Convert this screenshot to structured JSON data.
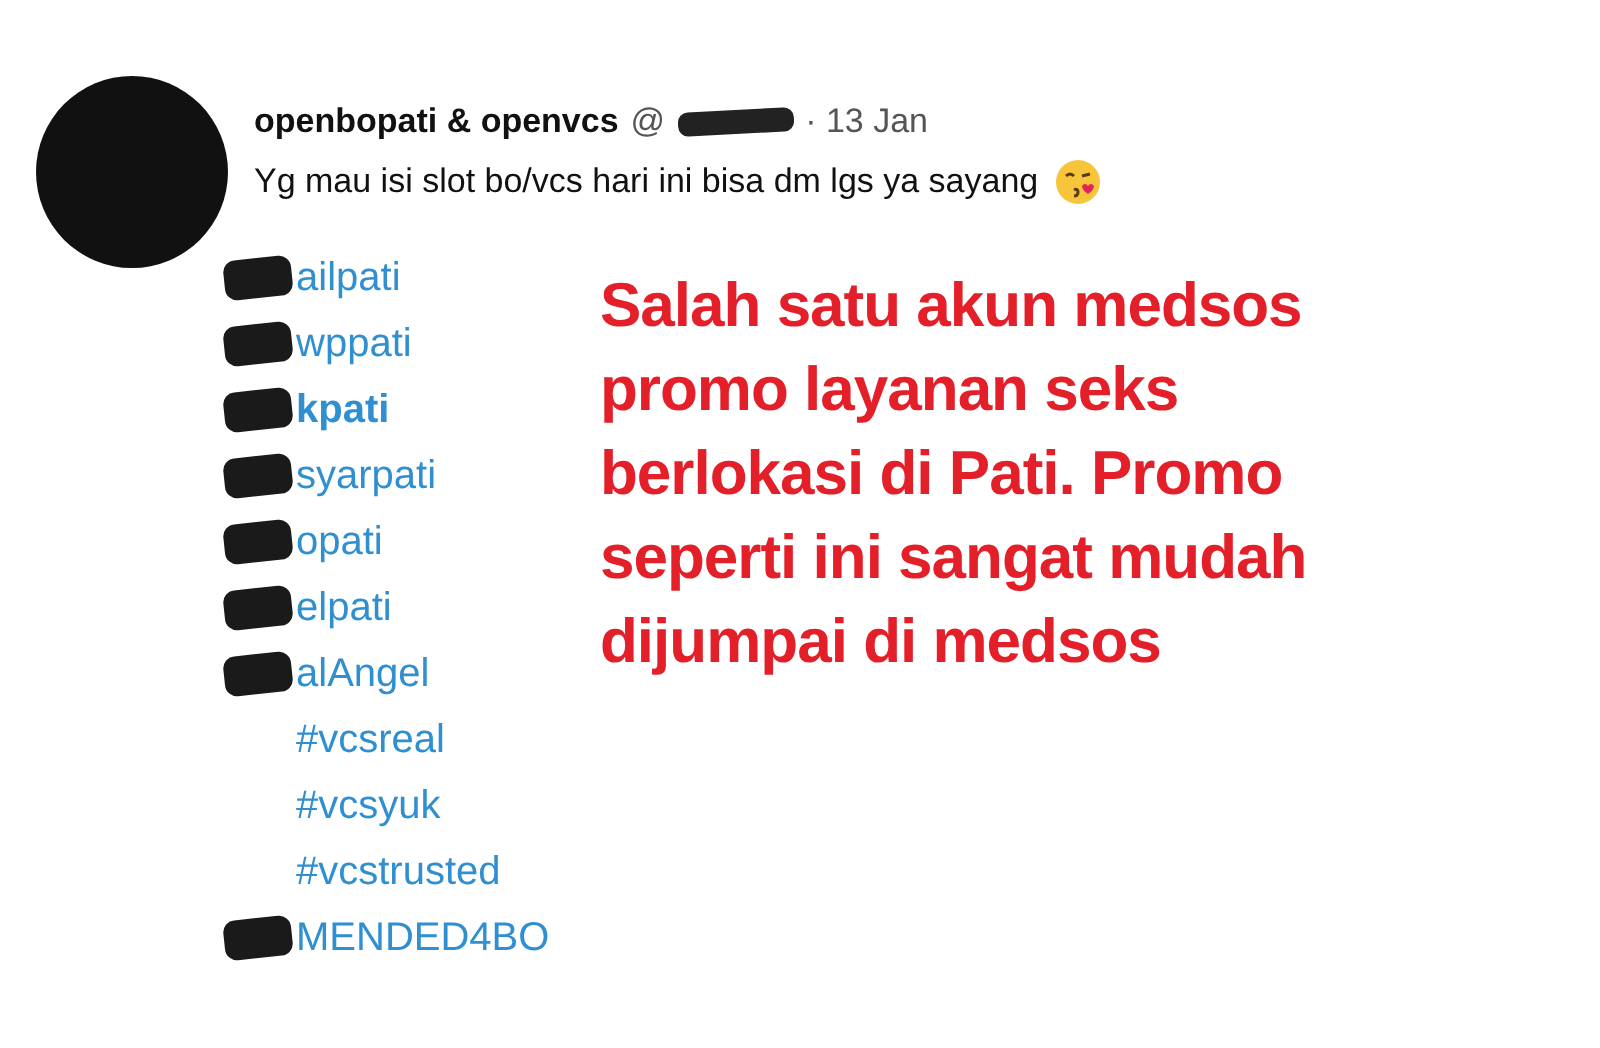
{
  "tweet": {
    "author": "openbopati & openvcs",
    "handle": "@",
    "date": "· 13 Jan",
    "text": "Yg mau isi slot bo/vcs hari ini bisa dm lgs ya sayang",
    "hashtags": [
      {
        "text": "ailpati",
        "redacted": true,
        "bold": false
      },
      {
        "text": "wppati",
        "redacted": true,
        "bold": false
      },
      {
        "text": "kpati",
        "redacted": true,
        "bold": true
      },
      {
        "text": "syarpati",
        "redacted": true,
        "bold": false
      },
      {
        "text": "opati",
        "redacted": true,
        "bold": false
      },
      {
        "text": "elpati",
        "redacted": true,
        "bold": false
      },
      {
        "text": "alAngel",
        "redacted": true,
        "bold": false
      },
      {
        "text": "#vcsreal",
        "redacted": false,
        "bold": false
      },
      {
        "text": "#vcsyuk",
        "redacted": false,
        "bold": false
      },
      {
        "text": "#vcstrusted",
        "redacted": false,
        "bold": false
      },
      {
        "text": "MENDED4BO",
        "redacted": true,
        "bold": false
      }
    ]
  },
  "caption": "Salah satu akun medsos\npromo layanan seks\nberlokasi di Pati. Promo\nseperti ini sangat mudah\ndijumpai di medsos"
}
